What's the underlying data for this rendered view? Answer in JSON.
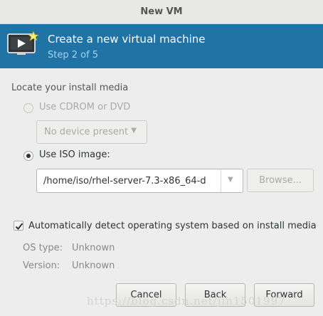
{
  "window": {
    "title": "New VM"
  },
  "header": {
    "icon": "monitor-star-icon",
    "title": "Create a new virtual machine",
    "step": "Step 2 of 5"
  },
  "media": {
    "section_label": "Locate your install media",
    "cdrom_label": "Use CDROM or DVD",
    "cdrom_selected": false,
    "cdrom_enabled": false,
    "device_value": "No device present",
    "iso_label": "Use ISO image:",
    "iso_selected": true,
    "iso_path": "/home/iso/rhel-server-7.3-x86_64-d",
    "browse_label": "Browse..."
  },
  "detect": {
    "checked": true,
    "label": "Automatically detect operating system based on install media",
    "os_type_label": "OS type:",
    "os_type_value": "Unknown",
    "version_label": "Version:",
    "version_value": "Unknown"
  },
  "footer": {
    "cancel_label": "Cancel",
    "back_label": "Back",
    "forward_label": "Forward"
  },
  "watermark": "https://blog.csdn.net/jin1501997",
  "colors": {
    "banner": "#1f73a5",
    "step_text": "#a9d1ec"
  }
}
